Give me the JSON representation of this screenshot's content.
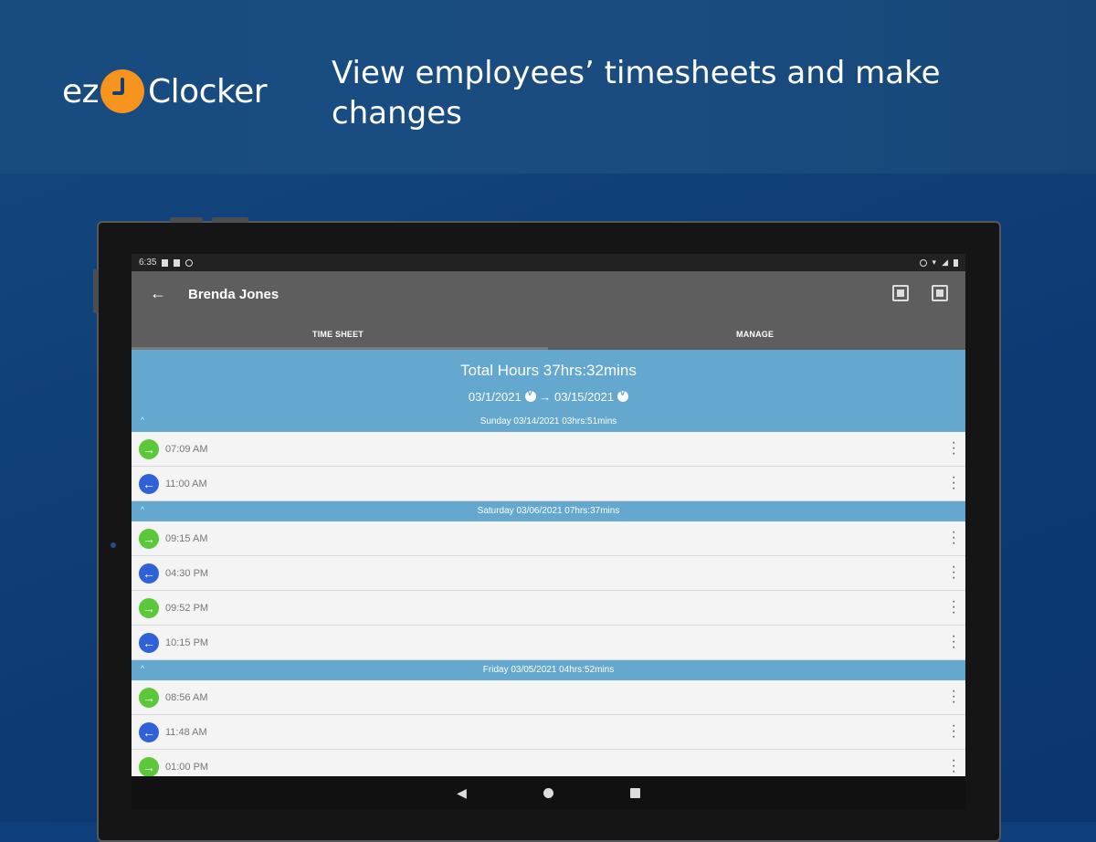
{
  "brand": {
    "ez": "ez",
    "name": "Clocker"
  },
  "tagline": "View employees’ timesheets and make changes",
  "status": {
    "time": "6:35"
  },
  "app": {
    "employee_name": "Brenda Jones",
    "tabs": [
      "TIME SHEET",
      "MANAGE"
    ],
    "summary": {
      "total_hours": "Total Hours 37hrs:32mins",
      "start_date": "03/1/2021",
      "arrow": "→",
      "end_date": "03/15/2021"
    },
    "days": [
      {
        "header": "Sunday 03/14/2021  03hrs:51mins",
        "entries": [
          {
            "type": "in",
            "time": "07:09 AM"
          },
          {
            "type": "out",
            "time": "11:00 AM"
          }
        ]
      },
      {
        "header": "Saturday 03/06/2021  07hrs:37mins",
        "entries": [
          {
            "type": "in",
            "time": "09:15 AM"
          },
          {
            "type": "out",
            "time": "04:30 PM"
          },
          {
            "type": "in",
            "time": "09:52 PM"
          },
          {
            "type": "out",
            "time": "10:15 PM"
          }
        ]
      },
      {
        "header": "Friday 03/05/2021  04hrs:52mins",
        "entries": [
          {
            "type": "in",
            "time": "08:56 AM"
          },
          {
            "type": "out",
            "time": "11:48 AM"
          },
          {
            "type": "in",
            "time": "01:00 PM"
          }
        ]
      }
    ]
  },
  "colors": {
    "background": "#0f3f7a",
    "logo_clock": "#f7941d",
    "header_blue": "#64a7cf",
    "clock_in": "#5bc83a",
    "clock_out": "#2f62d8",
    "appbar": "#5e5e5e"
  },
  "icons": {
    "back": "arrow-left-icon",
    "action1": "export-icon",
    "action2": "share-icon",
    "clock_in": "arrow-right-icon",
    "clock_out": "arrow-left-icon",
    "more": "more-vert-icon"
  }
}
